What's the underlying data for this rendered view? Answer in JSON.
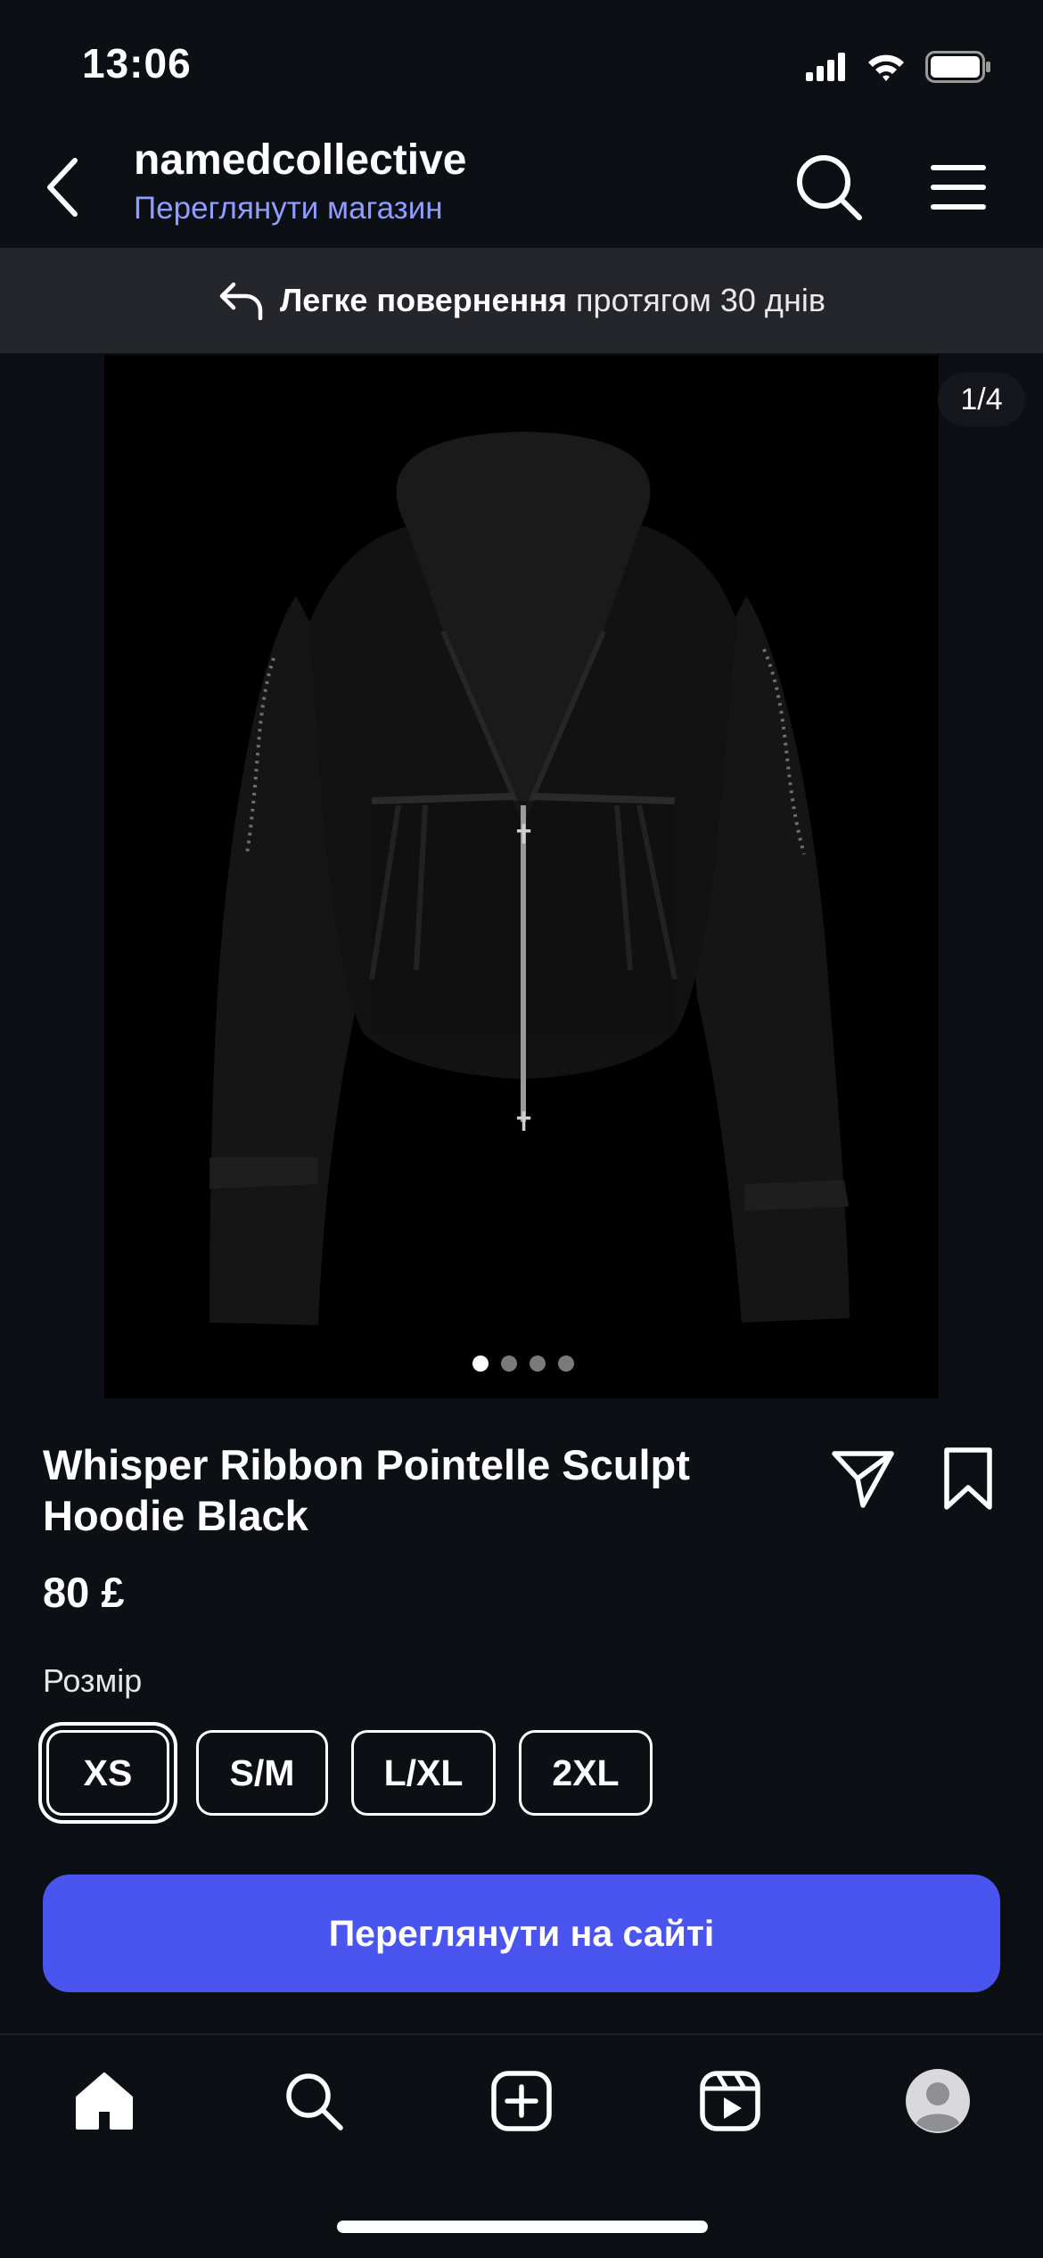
{
  "status_bar": {
    "time": "13:06"
  },
  "header": {
    "shop_name": "namedcollective",
    "shop_link": "Переглянути магазин"
  },
  "returns_banner": {
    "bold": "Легке повернення",
    "rest": "протягом 30 днів"
  },
  "gallery": {
    "counter": "1/4",
    "pages": 4,
    "current_page": 1
  },
  "product": {
    "title": "Whisper Ribbon Pointelle Sculpt Hoodie Black",
    "price": "80 £",
    "size_label": "Розмір",
    "sizes": [
      "XS",
      "S/M",
      "L/XL",
      "2XL"
    ],
    "selected_size": "XS",
    "cta": "Переглянути на сайті"
  },
  "icons": {
    "back": "chevron-left-icon",
    "search": "search-icon",
    "menu": "hamburger-icon",
    "returns": "return-arrow-icon",
    "share": "paper-plane-icon",
    "save": "bookmark-icon",
    "nav": [
      "home-icon",
      "search-icon",
      "plus-square-icon",
      "reels-icon",
      "avatar-icon"
    ]
  },
  "colors": {
    "background": "#0c0f14",
    "accent": "#4a55f0",
    "link": "#8f9dff",
    "banner": "#24262b"
  }
}
